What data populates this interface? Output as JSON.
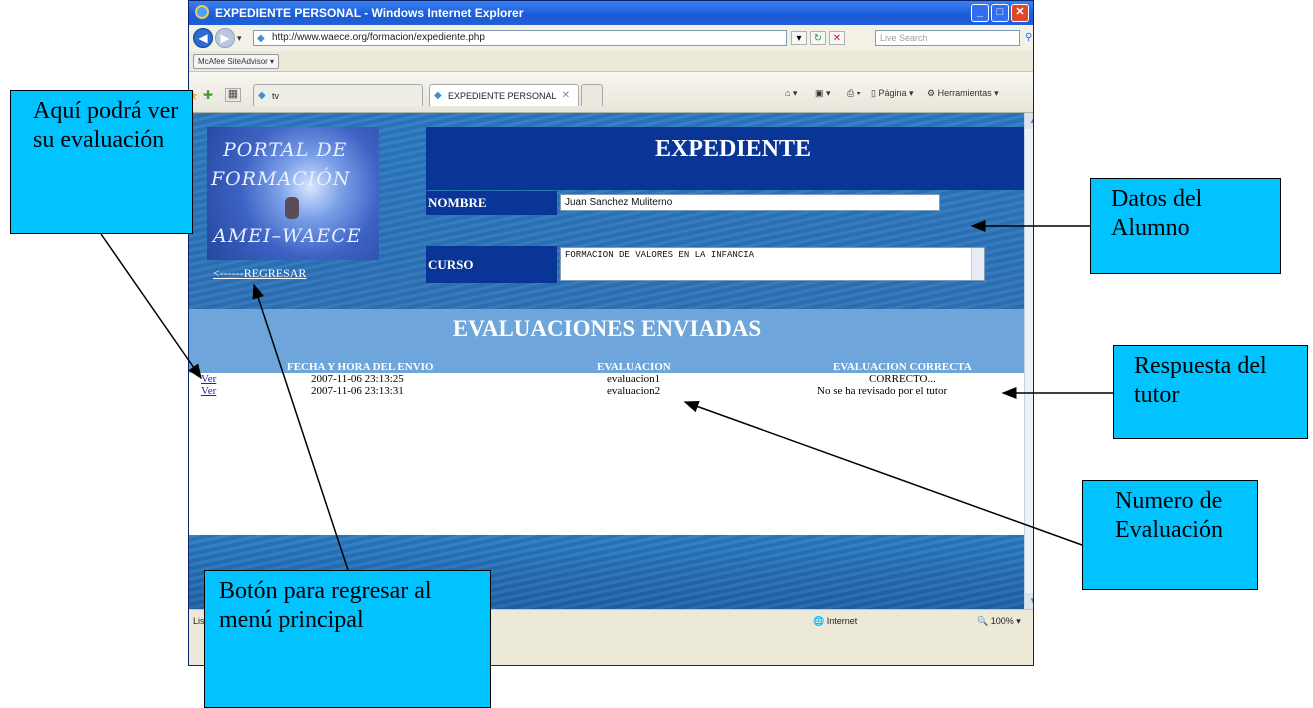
{
  "browser": {
    "title": "EXPEDIENTE PERSONAL - Windows Internet Explorer",
    "url": "http://www.waece.org/formacion/expediente.php",
    "search_placeholder": "Live Search",
    "mcafee": "McAfee SiteAdvisor",
    "tabs": [
      {
        "label": "tv"
      },
      {
        "label": "EXPEDIENTE PERSONAL"
      }
    ],
    "tools": {
      "page": "Página",
      "tools": "Herramientas"
    },
    "status": {
      "text": "Lis",
      "zone": "Internet",
      "zoom": "100%"
    }
  },
  "page": {
    "logo_lines": [
      "PORTAL DE",
      "FORMACIÓN",
      "AMEI–WAECE"
    ],
    "back_link": "<------REGRESAR",
    "title": "EXPEDIENTE",
    "nombre_label": "NOMBRE",
    "nombre_value": "Juan Sanchez Muliterno",
    "curso_label": "CURSO",
    "curso_value": "FORMACION DE VALORES EN LA INFANCIA",
    "section_title": "EVALUACIONES ENVIADAS",
    "table": {
      "headers": [
        "FECHA Y HORA DEL ENVIO",
        "EVALUACION",
        "EVALUACION CORRECTA"
      ],
      "rows": [
        {
          "link": "Ver",
          "fecha": "2007-11-06 23:13:25",
          "evaluacion": "evaluacion1",
          "correcta": "CORRECTO..."
        },
        {
          "link": "Ver",
          "fecha": "2007-11-06 23:13:31",
          "evaluacion": "evaluacion2",
          "correcta": "No se ha revisado por el tutor"
        }
      ]
    }
  },
  "callouts": {
    "evaluacion": "Aquí podrá ver su evaluación",
    "datos": "Datos del Alumno",
    "respuesta": "Respuesta del tutor",
    "numero": "Numero de Evaluación",
    "boton": "Botón para regresar al menú principal"
  },
  "colors": {
    "callout_bg": "#00c3ff",
    "header_navy": "#093596",
    "section_light": "#6ea5da",
    "page_blue": "#2c6fb4"
  }
}
